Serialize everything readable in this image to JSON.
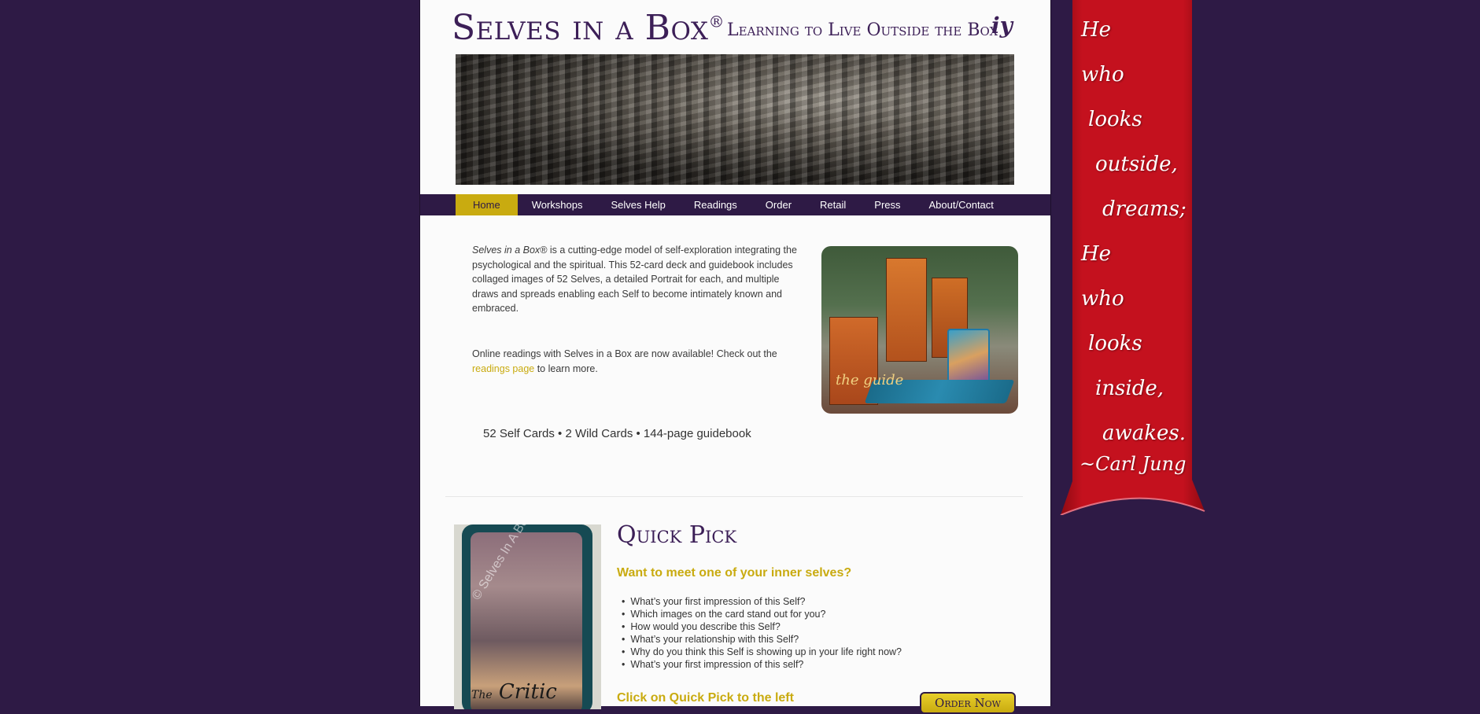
{
  "site": {
    "title": "Selves in a Box",
    "title_mark": "®",
    "tagline": "Learning to Live Outside the Box",
    "logo_glyph": "iy"
  },
  "nav": {
    "items": [
      {
        "label": "Home",
        "active": true
      },
      {
        "label": "Workshops"
      },
      {
        "label": "Selves Help"
      },
      {
        "label": "Readings"
      },
      {
        "label": "Order"
      },
      {
        "label": "Retail"
      },
      {
        "label": "Press"
      },
      {
        "label": "About/Contact"
      }
    ]
  },
  "intro": {
    "product_name": "Selves in a Box®",
    "paragraph_rest": " is a cutting-edge model of self-exploration integrating the psychological and the spiritual. This 52-card deck and guidebook includes collaged images of 52 Selves, a detailed Portrait for each, and multiple draws and spreads enabling each Self to become intimately known and embraced.",
    "readings_before": "Online readings with Selves in a Box are now available! Check out the ",
    "readings_link": "readings page",
    "readings_after": " to learn more.",
    "stats": "52 Self Cards • 2 Wild Cards • 144-page guidebook"
  },
  "product_photo": {
    "guide_text": "the guide"
  },
  "quick_pick": {
    "heading": "Quick Pick",
    "subheading": "Want to meet one of your inner selves?",
    "questions": [
      "What’s your first impression of this Self?",
      "Which images on the card stand out for you?",
      "How would you describe this Self?",
      "What’s your relationship with this Self?",
      "Why do you think this Self is showing up in your life right now?",
      "What’s your first impression of this self?"
    ],
    "cta": "Click on Quick Pick to the left",
    "order_button": "Order Now",
    "card": {
      "watermark": "© Selves In A Box",
      "title_prefix": "The",
      "title": "Critic"
    }
  },
  "quote": {
    "lines": [
      "He",
      "who",
      "looks",
      "outside,",
      "dreams;",
      "He",
      "who",
      "looks",
      "inside,",
      "awakes."
    ],
    "author": "~Carl Jung"
  },
  "colors": {
    "background": "#2e1a45",
    "accent_gold": "#c9ab10",
    "brand_purple": "#3c1f57",
    "banner_red": "#c4111e"
  }
}
